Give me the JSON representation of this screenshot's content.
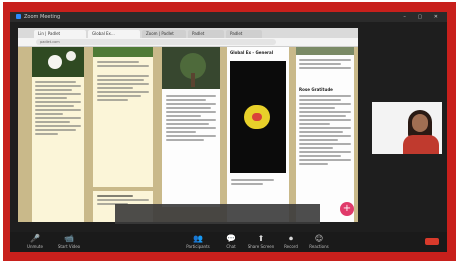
{
  "window": {
    "title": "Zoom Meeting"
  },
  "browser": {
    "tabs": [
      "Lin | Padlet",
      "Global Ex...",
      "Zoom | Padlet",
      "Padlet",
      "Padlet"
    ],
    "url": "padlet.com"
  },
  "padlet": {
    "cards": [
      {
        "title": "",
        "photo": "jasmine flowers"
      },
      {
        "title": "",
        "photo": "leaves"
      },
      {
        "title": "",
        "photo": "tree"
      },
      {
        "title": "Global Ex - General",
        "photo": "yellow flower"
      },
      {
        "title": "Rose Gratitude",
        "photo": ""
      },
      {
        "title": "",
        "photo": ""
      }
    ],
    "fab_label": "+"
  },
  "toolbar": {
    "mute": "Unmute",
    "video": "Start Video",
    "participants": "Participants",
    "chat": "Chat",
    "share": "Share Screen",
    "record": "Record",
    "reactions": "Reactions"
  },
  "colors": {
    "frame": "#c8201c",
    "zoom_bg": "#1e1e1e",
    "share_green": "#35c15a",
    "end_red": "#d83a2b",
    "padlet_bg": "#c9b98a"
  }
}
